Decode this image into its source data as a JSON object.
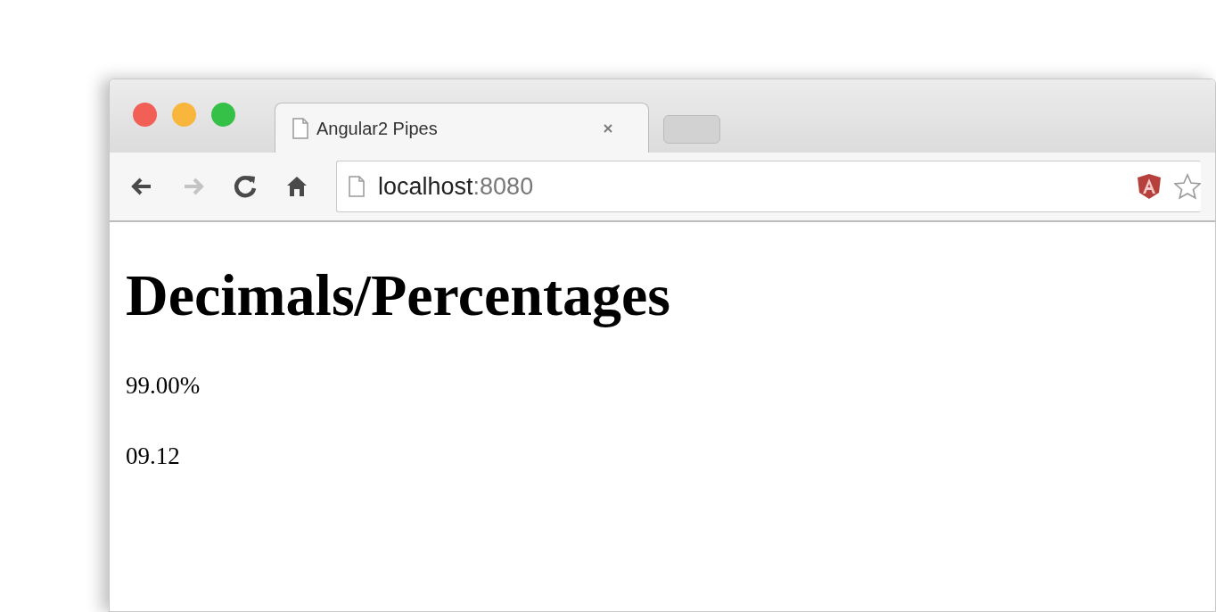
{
  "window": {
    "controls": [
      {
        "color": "#f25f57"
      },
      {
        "color": "#f8b73c"
      },
      {
        "color": "#35c148"
      }
    ]
  },
  "tabs": [
    {
      "title": "Angular2 Pipes",
      "selected": true
    }
  ],
  "toolbar": {
    "nav_buttons": [
      {
        "kind": "back",
        "disabled": false
      },
      {
        "kind": "forward",
        "disabled": true
      },
      {
        "kind": "reload",
        "disabled": false
      },
      {
        "kind": "home",
        "disabled": false
      }
    ],
    "address": {
      "host": "localhost",
      "port": ":8080"
    }
  },
  "page": {
    "heading": "Decimals/Percentages",
    "lines": [
      "99.00%",
      "09.12"
    ]
  }
}
